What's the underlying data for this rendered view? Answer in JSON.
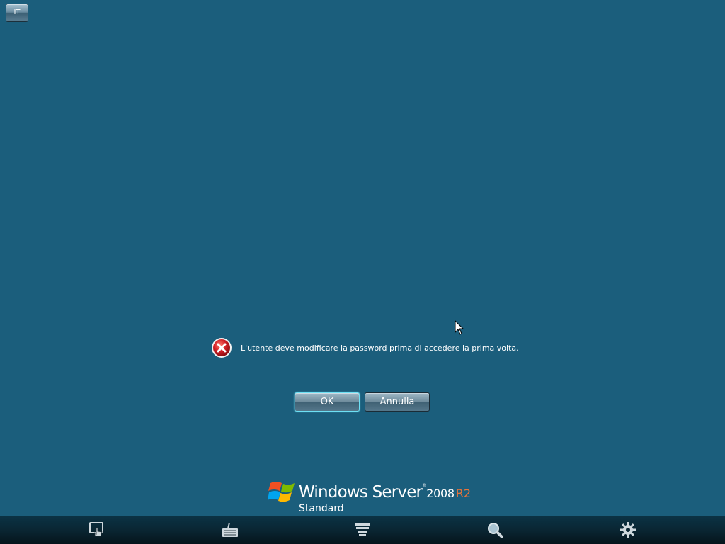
{
  "language_button": {
    "label": "IT"
  },
  "dialog": {
    "message": "L'utente deve modificare la password prima di accedere la prima volta.",
    "ok_label": "OK",
    "cancel_label": "Annulla"
  },
  "branding": {
    "product": "Windows Server",
    "trademark": "®",
    "version": "2008",
    "release": "R2",
    "edition": "Standard"
  },
  "taskbar": {
    "icons": [
      "ease-of-access-icon",
      "on-screen-keyboard-icon",
      "narrator-icon",
      "magnifier-icon",
      "settings-icon"
    ]
  },
  "colors": {
    "background": "#1b5e7c",
    "error_red": "#d11f25",
    "release_accent": "#e8743a",
    "ok_focus": "#6ee0f4"
  }
}
